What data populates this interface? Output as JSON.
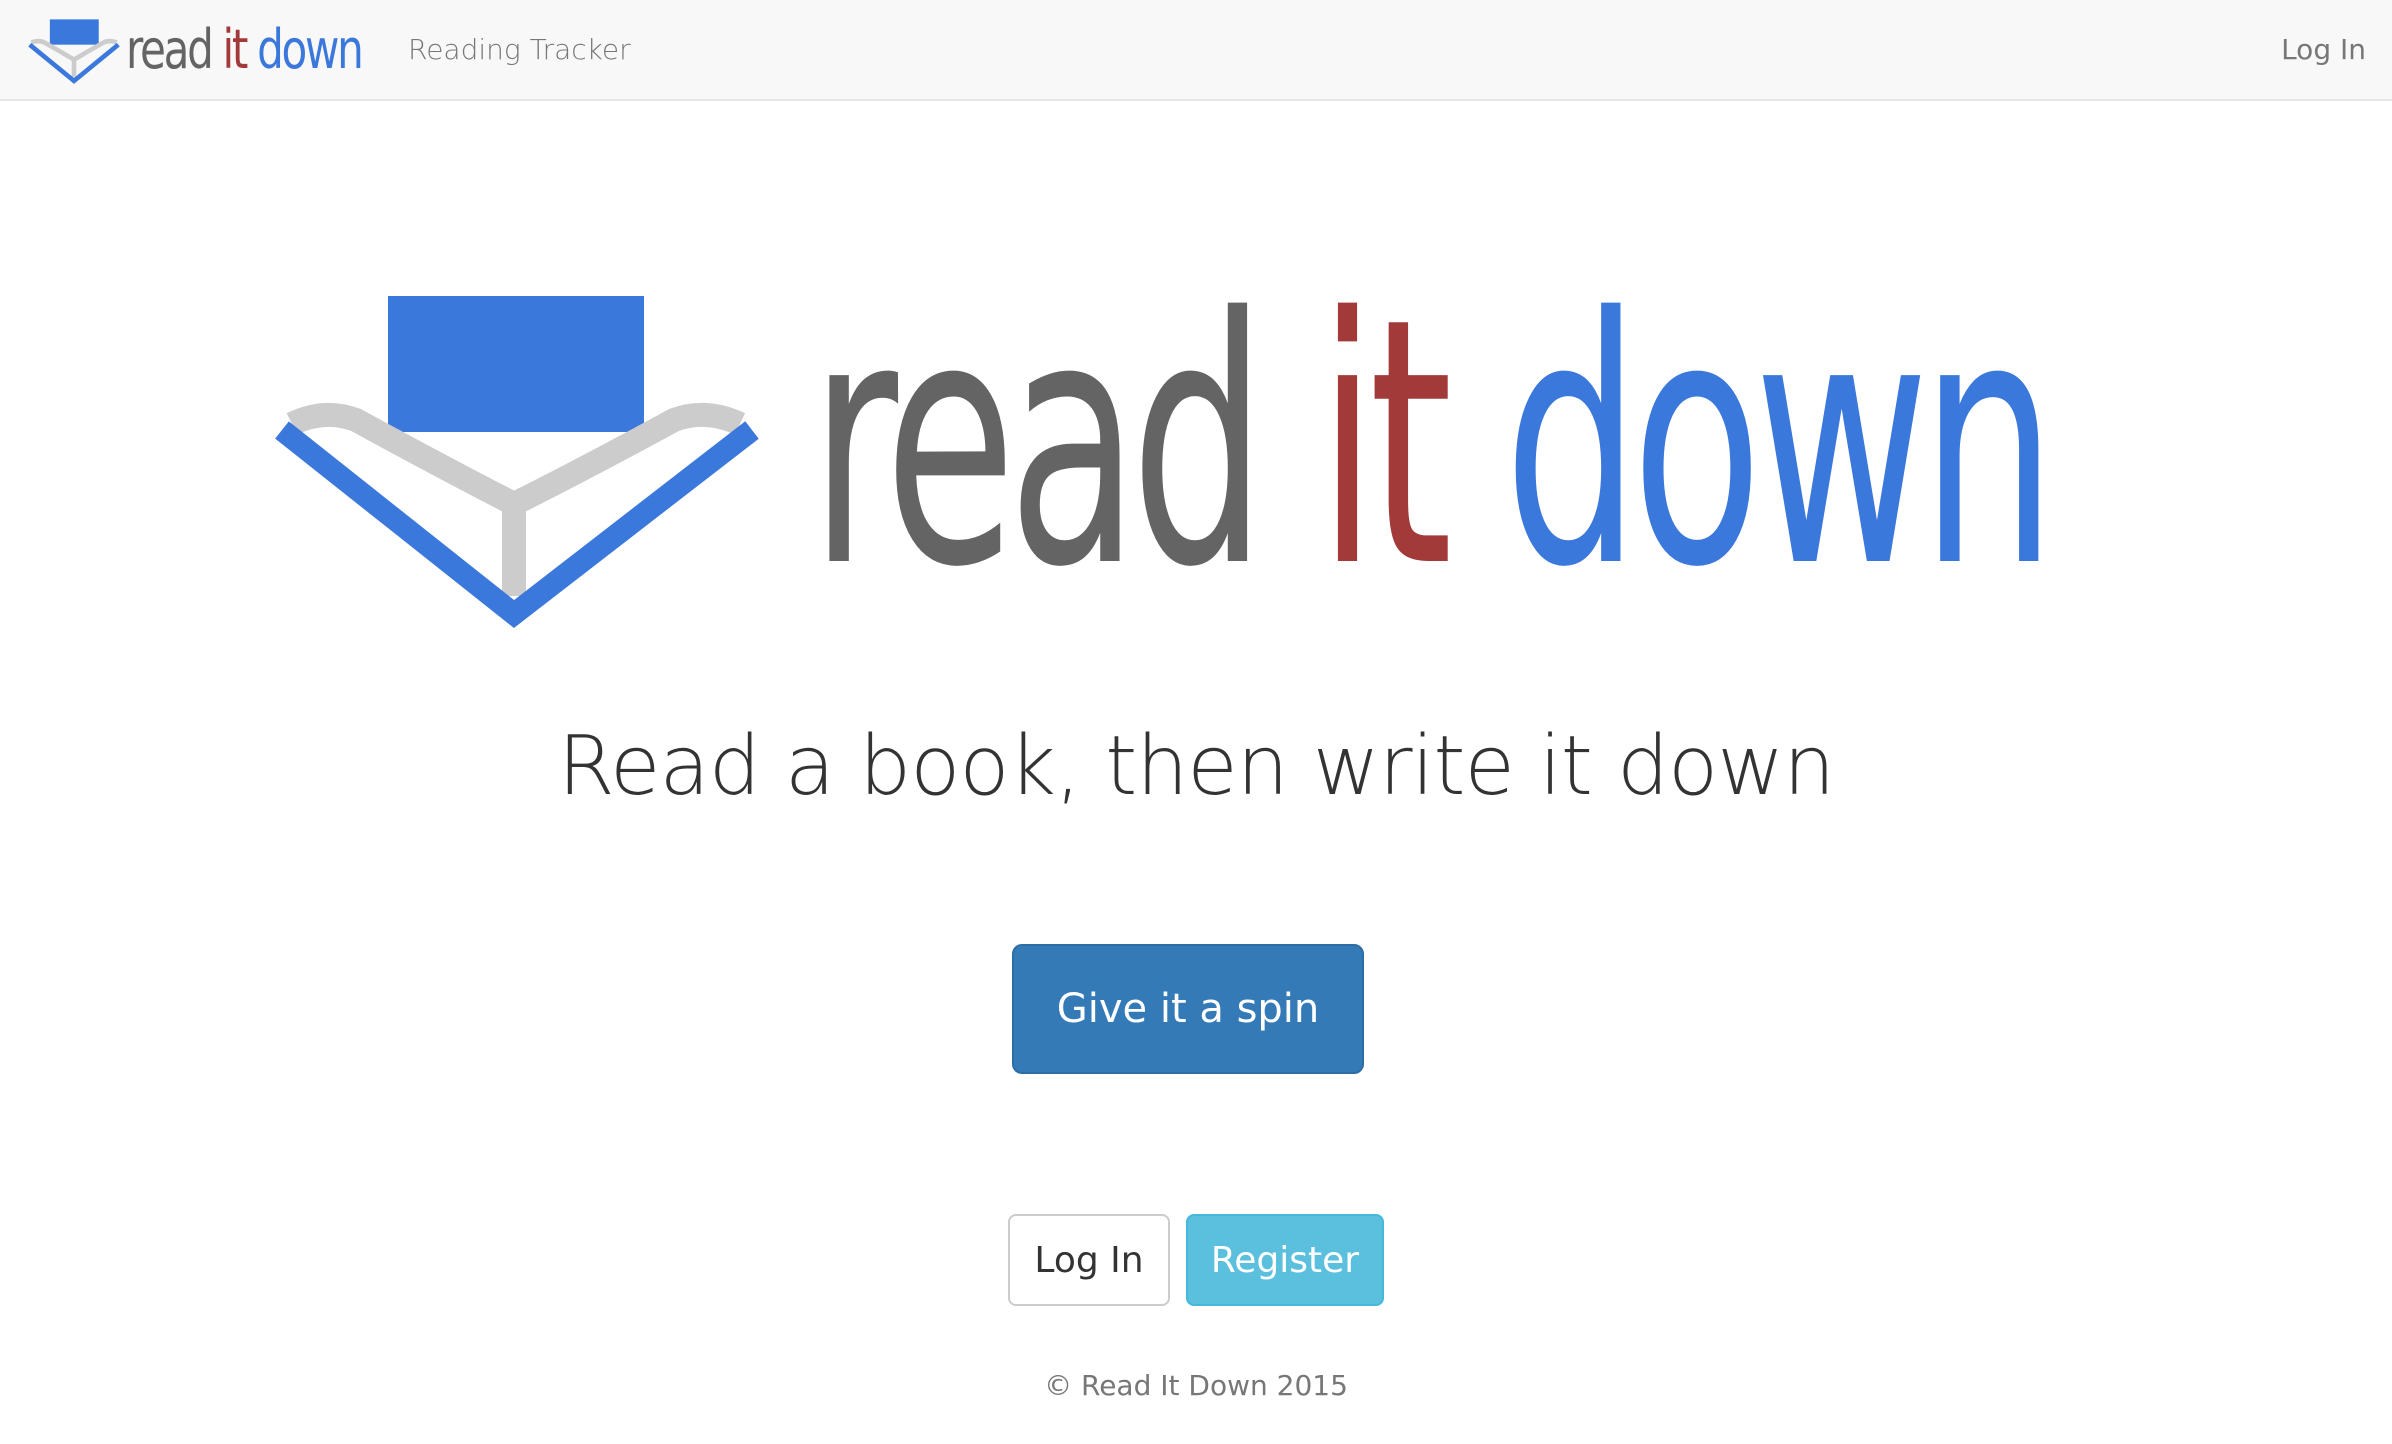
{
  "navbar": {
    "brand": {
      "read": "read",
      "it": "it",
      "down": "down"
    },
    "tagline": "Reading Tracker",
    "login_link": "Log In"
  },
  "hero": {
    "logo": {
      "read": "read",
      "it": "it",
      "down": "down"
    },
    "tagline": "Read a book, then write it down",
    "cta_button": "Give it a spin"
  },
  "auth": {
    "login_button": "Log In",
    "register_button": "Register"
  },
  "footer": {
    "copyright": "© Read It Down 2015"
  },
  "colors": {
    "brand_blue": "#3b78db",
    "brand_red": "#a23a3a",
    "brand_gray": "#646464",
    "primary_button": "#337ab7",
    "info_button": "#5bc0de"
  },
  "icons": {
    "logo_icon": "open-book-download-icon"
  }
}
